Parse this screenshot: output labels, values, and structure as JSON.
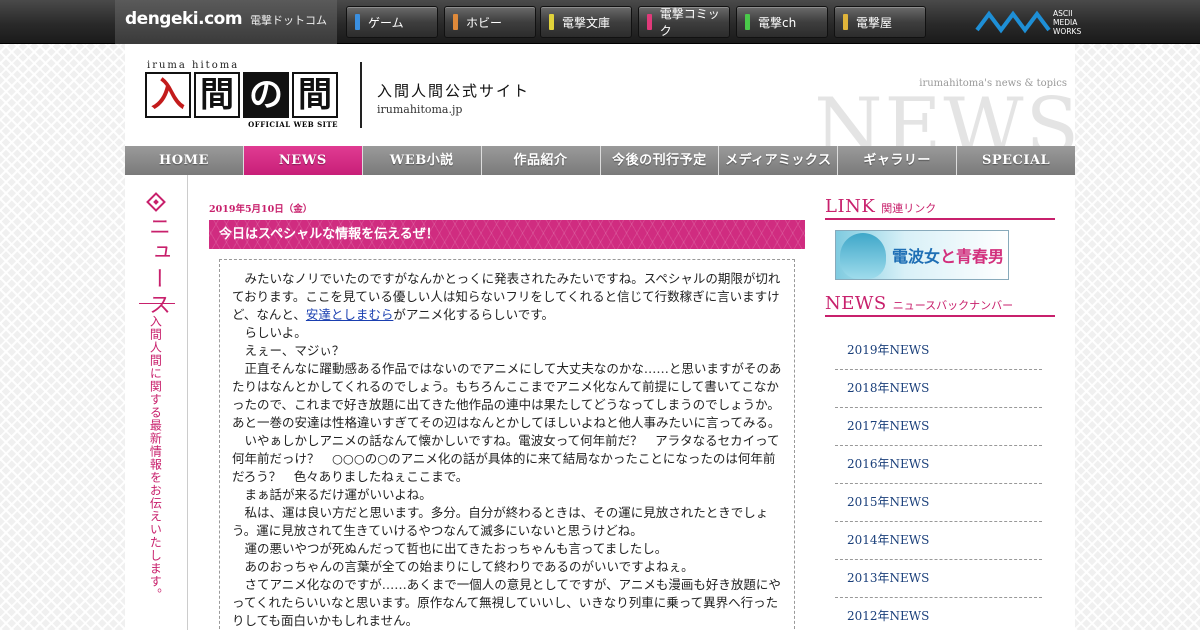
{
  "portal": {
    "brand": "dengeki.com",
    "brand_sub": "電撃ドットコム",
    "buttons": [
      {
        "label": "ゲーム",
        "color": "#3a8fe0"
      },
      {
        "label": "ホビー",
        "color": "#e08a3a"
      },
      {
        "label": "電撃文庫",
        "color": "#e0d23a"
      },
      {
        "label": "電撃コミック",
        "color": "#e03a7a"
      },
      {
        "label": "電撃ch",
        "color": "#4ac94a"
      },
      {
        "label": "電撃屋",
        "color": "#e0b43a"
      }
    ],
    "publisher_line1": "ASCII",
    "publisher_line2": "MEDIA",
    "publisher_line3": "WORKS"
  },
  "header": {
    "romaji": "iruma hitoma",
    "logo_chars": [
      "入",
      "間",
      "の",
      "間"
    ],
    "official": "OFFICIAL WEB SITE",
    "title": "入間人間公式サイト",
    "url": "irumahitoma.jp",
    "topics": "irumahitoma's news & topics",
    "big_word": "NEWS"
  },
  "nav": [
    {
      "label": "HOME"
    },
    {
      "label": "NEWS"
    },
    {
      "label": "WEB小説"
    },
    {
      "label": "作品紹介"
    },
    {
      "label": "今後の刊行予定"
    },
    {
      "label": "メディアミックス"
    },
    {
      "label": "ギャラリー"
    },
    {
      "label": "SPECIAL"
    }
  ],
  "side": {
    "title": "ニュース",
    "desc": "入間人間に関する最新情報をお伝えいたします。"
  },
  "article": {
    "date": "2019年5月10日（金）",
    "title": "今日はスペシャルな情報を伝えるぜ！",
    "p1_before": "みたいなノリでいたのですがなんかとっくに発表されたみたいですね。スペシャルの期限が切れております。ここを見ている優しい人は知らないフリをしてくれると信じて行数稼ぎに言いますけど、なんと、",
    "p1_link": "安達としまむら",
    "p1_after": "がアニメ化するらしいです。",
    "paragraphs": [
      "らしいよ。",
      "えぇー、マジぃ？",
      "正直そんなに躍動感ある作品ではないのでアニメにして大丈夫なのかな……と思いますがそのあたりはなんとかしてくれるのでしょう。もちろんここまでアニメ化なんて前提にして書いてこなかったので、これまで好き放題に出てきた他作品の連中は果たしてどうなってしまうのでしょうか。あと一巻の安達は性格違いすぎてその辺はなんとかしてほしいよねと他人事みたいに言ってみる。",
      "いやぁしかしアニメの話なんて懐かしいですね。電波女って何年前だ？　アラタなるセカイって何年前だっけ？　○○○の○のアニメ化の話が具体的に来て結局なかったことになったのは何年前だろう？　色々ありましたねぇここまで。",
      "まぁ話が来るだけ運がいいよね。",
      "私は、運は良い方だと思います。多分。自分が終わるときは、その運に見放されたときでしょう。運に見放されて生きていけるやつなんて滅多にいないと思うけどね。",
      "運の悪いやつが死ぬんだって哲也に出てきたおっちゃんも言ってましたし。",
      "あのおっちゃんの言葉が全ての始まりにして終わりであるのがいいですよねぇ。",
      "さてアニメ化なのですが……あくまで一個人の意見としてですが、アニメも漫画も好き放題にやってくれたらいいなと思います。原作なんて無視していいし、いきなり列車に乗って異界へ行ったりしても面白いかもしれません。"
    ]
  },
  "right": {
    "link_en": "LINK",
    "link_jp": "関連リンク",
    "banner_a": "電波女",
    "banner_b": "と青春男",
    "news_en": "NEWS",
    "news_jp": "ニュースバックナンバー",
    "archive": [
      "2019年NEWS",
      "2018年NEWS",
      "2017年NEWS",
      "2016年NEWS",
      "2015年NEWS",
      "2014年NEWS",
      "2013年NEWS",
      "2012年NEWS"
    ]
  }
}
